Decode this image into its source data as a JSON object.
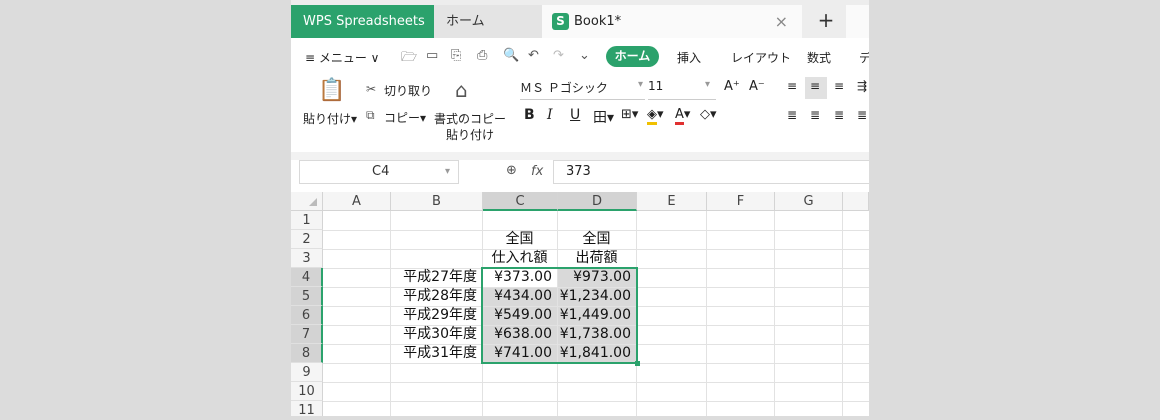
{
  "tabs": {
    "brand": "WPS Spreadsheets",
    "home": "ホーム",
    "book": "Book1*",
    "book_icon": "S",
    "close": "×",
    "new": "+"
  },
  "menu": {
    "menu_label": "≡ メニュー ∨",
    "items": [
      "ホーム",
      "挿入",
      "レイアウト",
      "数式",
      "デ"
    ]
  },
  "ribbon": {
    "paste": "貼り付け",
    "cut": "切り取り",
    "copy": "コピー",
    "format_copy_1": "書式のコピー",
    "format_copy_2": "貼り付け",
    "font": "ＭＳ Ｐゴシック",
    "size": "11"
  },
  "formula_bar": {
    "cell_ref": "C4",
    "formula": "373",
    "fx": "fx"
  },
  "sheet": {
    "columns": [
      "A",
      "B",
      "C",
      "D",
      "E",
      "F",
      "G"
    ],
    "rows": [
      "1",
      "2",
      "3",
      "4",
      "5",
      "6",
      "7",
      "8",
      "9",
      "10",
      "11"
    ],
    "header_c_1": "全国",
    "header_c_2": "仕入れ額",
    "header_d_1": "全国",
    "header_d_2": "出荷額",
    "data": [
      {
        "year": "平成27年度",
        "c": "¥373.00",
        "d": "¥973.00"
      },
      {
        "year": "平成28年度",
        "c": "¥434.00",
        "d": "¥1,234.00"
      },
      {
        "year": "平成29年度",
        "c": "¥549.00",
        "d": "¥1,449.00"
      },
      {
        "year": "平成30年度",
        "c": "¥638.00",
        "d": "¥1,738.00"
      },
      {
        "year": "平成31年度",
        "c": "¥741.00",
        "d": "¥1,841.00"
      }
    ]
  },
  "colors": {
    "accent": "#2ba26c",
    "selection": "#d9d9d9"
  }
}
